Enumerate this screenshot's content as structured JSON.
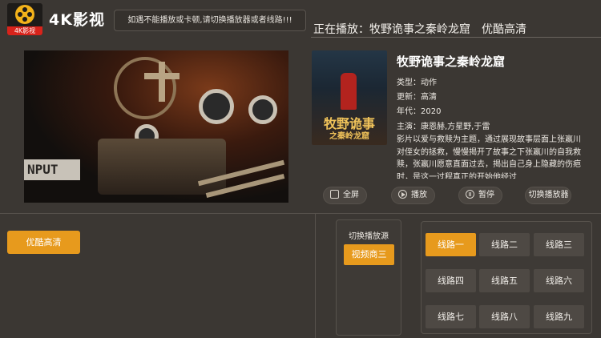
{
  "header": {
    "logo_tag": "4K影视",
    "app_title": "4K影视",
    "notice": "如遇不能播放或卡顿,请切换播放器或者线路!!!",
    "now_playing_prefix": "正在播放：",
    "now_playing_title": "牧野诡事之秦岭龙窟",
    "now_playing_quality": "优酷高清"
  },
  "player": {
    "overlay_text": "NPUT"
  },
  "poster": {
    "title_line1": "牧野诡事",
    "title_line2": "之秦岭龙窟"
  },
  "movie": {
    "title": "牧野诡事之秦岭龙窟",
    "type": "类型：动作",
    "update": "更新：高清",
    "year": "年代：2020",
    "cast": "主演：康恩赫,方星野,于雷",
    "synopsis": "影片以爱与救赎为主题，通过展现故事层面上张嬴川对侄女的拯救，慢慢揭开了故事之下张嬴川的自我救赎，张嬴川愿意直面过去，揭出自己身上隐藏的伤疤时，是这一过程真正的开始他经过"
  },
  "controls": {
    "fullscreen": "全屏",
    "play": "播放",
    "pause": "暂停",
    "switch_player": "切换播放器"
  },
  "quality": {
    "selected": "优酷高清"
  },
  "source": {
    "label": "切换播放源",
    "selected": "视频商三"
  },
  "lines": {
    "items": [
      "线路一",
      "线路二",
      "线路三",
      "线路四",
      "线路五",
      "线路六",
      "线路七",
      "线路八",
      "线路九"
    ],
    "active_index": 0
  },
  "colors": {
    "accent": "#e79a1d",
    "background": "#3b3733",
    "logo_red": "#d8231b"
  }
}
